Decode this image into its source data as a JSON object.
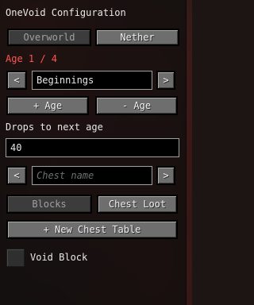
{
  "window": {
    "title": "OneVoid Configuration"
  },
  "dimension_tabs": [
    {
      "label": "Overworld",
      "active": false
    },
    {
      "label": "Nether",
      "active": true
    }
  ],
  "age": {
    "indicator": "Age 1 / 4",
    "indicator_color": "#ff5555",
    "name": "Beginnings",
    "prev_icon": "chevron-left-icon",
    "next_icon": "chevron-right-icon",
    "add_label": "+ Age",
    "remove_label": "- Age"
  },
  "drops": {
    "label": "Drops to next age",
    "value": "40"
  },
  "chest": {
    "placeholder": "Chest name",
    "prev_icon": "chevron-left-icon",
    "next_icon": "chevron-right-icon"
  },
  "mode_tabs": [
    {
      "label": "Blocks",
      "active": false
    },
    {
      "label": "Chest Loot",
      "active": true
    }
  ],
  "new_chest_table_label": "+ New Chest Table",
  "void_block": {
    "label": "Void Block",
    "checked": false
  },
  "colors": {
    "panel_bg": "#0e0e0e",
    "button_gray": "#6e6e6e",
    "button_inactive": "#3c3c3c",
    "accent_red": "#ff5555"
  }
}
